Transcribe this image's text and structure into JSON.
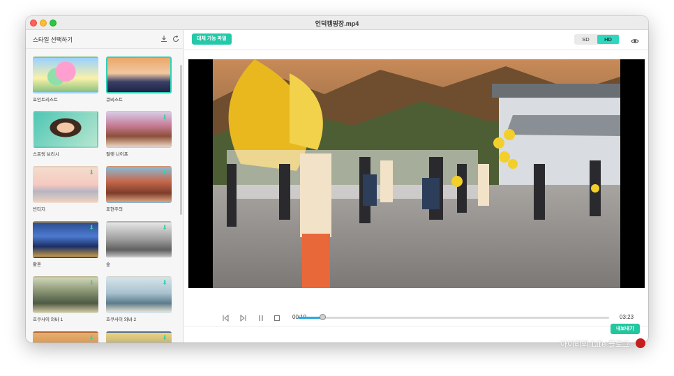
{
  "window": {
    "title": "언덕캠핑장.mp4"
  },
  "sidebar": {
    "title": "스타일 선택하기",
    "download_icon": "download-icon",
    "refresh_icon": "refresh-icon",
    "styles": [
      {
        "label": "포인트리스트",
        "selected": false,
        "downloadable": false
      },
      {
        "label": "큐비스트",
        "selected": true,
        "downloadable": false
      },
      {
        "label": "스프링 브리시",
        "selected": false,
        "downloadable": false
      },
      {
        "label": "팔렛 나이프",
        "selected": false,
        "downloadable": true
      },
      {
        "label": "빈티지",
        "selected": false,
        "downloadable": true
      },
      {
        "label": "표현주의",
        "selected": false,
        "downloadable": true
      },
      {
        "label": "황혼",
        "selected": false,
        "downloadable": true
      },
      {
        "label": "숲",
        "selected": false,
        "downloadable": true
      },
      {
        "label": "호쿠사이 와바 1",
        "selected": false,
        "downloadable": true
      },
      {
        "label": "호쿠사이 와바 2",
        "selected": false,
        "downloadable": true
      }
    ]
  },
  "toolbar": {
    "replace_button": "대체 가능 파일",
    "quality_options": [
      "SD",
      "HD"
    ],
    "quality_selected": "HD",
    "preview_icon": "eye-icon"
  },
  "player": {
    "current_time": "00:19",
    "total_time": "03:23",
    "progress_percent": 8
  },
  "export_button": "내보내기",
  "colors": {
    "accent": "#25c8a8",
    "progress": "#2aa9e0"
  }
}
